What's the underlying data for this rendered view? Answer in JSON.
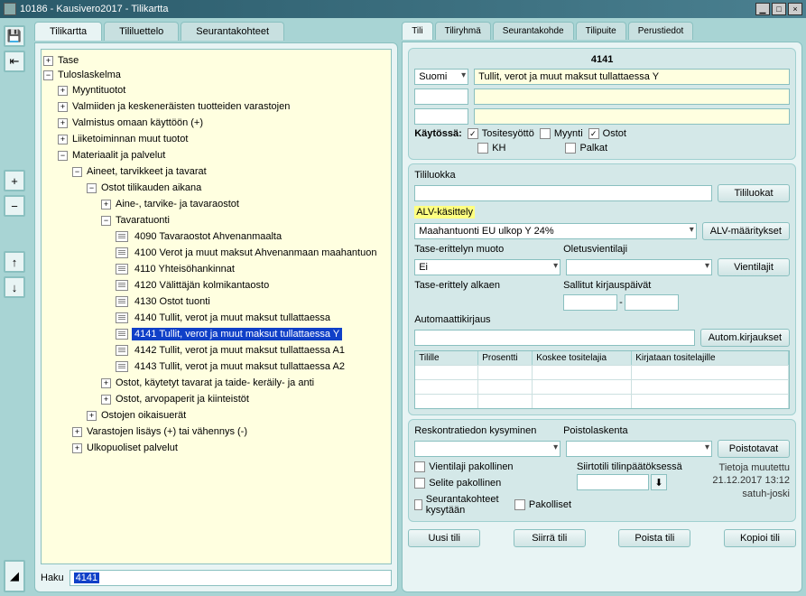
{
  "window": {
    "title": "10186 - Kausivero2017 - Tilikartta"
  },
  "leftTabs": [
    "Tilikartta",
    "Tililuettelo",
    "Seurantakohteet"
  ],
  "searchLabel": "Haku",
  "searchValue": "4141",
  "tree": {
    "tase": "Tase",
    "tulos": "Tuloslaskelma",
    "myynti": "Myyntituotot",
    "valmiiden": "Valmiiden ja keskeneräisten tuotteiden varastojen",
    "valmistus": "Valmistus omaan käyttöön (+)",
    "liike": "Liiketoiminnan muut tuotot",
    "materiaalit": "Materiaalit ja palvelut",
    "aineet": "Aineet, tarvikkeet ja tavarat",
    "ostotTk": "Ostot tilikauden aikana",
    "aineTarv": "Aine-, tarvike- ja tavaraostot",
    "tavaratuonti": "Tavaratuonti",
    "n4090": "4090 Tavaraostot Ahvenanmaalta",
    "n4100": "4100 Verot ja muut maksut Ahvenanmaan maahantuon",
    "n4110": "4110 Yhteisöhankinnat",
    "n4120": "4120 Välittäjän kolmikantaosto",
    "n4130": "4130 Ostot tuonti",
    "n4140": "4140 Tullit, verot ja muut maksut tullattaessa",
    "n4141": "4141 Tullit, verot ja muut maksut tullattaessa Y",
    "n4142": "4142 Tullit, verot ja muut maksut tullattaessa A1",
    "n4143": "4143 Tullit, verot ja muut maksut tullattaessa A2",
    "ostotKayt": "Ostot, käytetyt tavarat ja taide- keräily- ja anti",
    "ostotArvo": "Ostot, arvopaperit ja kiinteistöt",
    "ostoOik": "Ostojen oikaisuerät",
    "varast": "Varastojen lisäys (+) tai vähennys (-)",
    "ulkop": "Ulkopuoliset palvelut"
  },
  "rightTabs": [
    "Tili",
    "Tiliryhmä",
    "Seurantakohde",
    "Tilipuite",
    "Perustiedot"
  ],
  "account": {
    "number": "4141",
    "lang": "Suomi",
    "name": "Tullit, verot ja muut maksut tullattaessa Y",
    "kaytossaLabel": "Käytössä:",
    "chkTosite": "Tositesyöttö",
    "chkMyynti": "Myynti",
    "chkOstot": "Ostot",
    "chkKH": "KH",
    "chkPalkat": "Palkat"
  },
  "labels": {
    "tililuokka": "Tililuokka",
    "tililuokat": "Tililuokat",
    "alv": "ALV-käsittely",
    "alvValue": "Maahantuonti EU ulkop Y 24%",
    "alvMaar": "ALV-määritykset",
    "taseMuoto": "Tase-erittelyn muoto",
    "ei": "Ei",
    "oletusv": "Oletusvientilaji",
    "vientilajit": "Vientilajit",
    "taseAlk": "Tase-erittely alkaen",
    "sallitut": "Sallitut kirjauspäivät",
    "autok": "Automaattikirjaus",
    "autokBtn": "Autom.kirjaukset",
    "gTilille": "Tilille",
    "gProsentti": "Prosentti",
    "gKoskee": "Koskee tositelajia",
    "gKirjataan": "Kirjataan tositelajille",
    "reskontra": "Reskontratiedon kysyminen",
    "poistol": "Poistolaskenta",
    "poistotavat": "Poistotavat",
    "vientiPak": "Vientilaji pakollinen",
    "selitePak": "Selite pakollinen",
    "seurantaKys": "Seurantakohteet kysytään",
    "pakolliset": "Pakolliset",
    "siirtotili": "Siirtotili tilinpäätöksessä",
    "tietoja": "Tietoja muutettu",
    "muutettuDate": "21.12.2017 13:12",
    "muutettuUser": "satuh-joski",
    "uusiTili": "Uusi tili",
    "siirraTili": "Siirrä tili",
    "poistaTili": "Poista tili",
    "kopioiTili": "Kopioi tili"
  }
}
